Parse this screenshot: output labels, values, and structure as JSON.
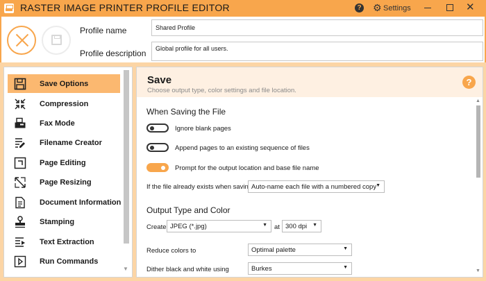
{
  "window": {
    "title": "RASTER IMAGE PRINTER PROFILE EDITOR",
    "help_glyph": "?",
    "settings_glyph": "⚙",
    "settings_label": "Settings",
    "close_glyph": "✕",
    "accent_color": "#f8a64c"
  },
  "profile": {
    "name_label": "Profile name",
    "name_value": "Shared Profile",
    "description_label": "Profile description",
    "description_value": "Global profile for all users."
  },
  "sidebar": {
    "items": [
      {
        "label": "Save Options",
        "icon": "floppy-disk-icon"
      },
      {
        "label": "Compression",
        "icon": "compress-arrows-icon"
      },
      {
        "label": "Fax Mode",
        "icon": "fax-machine-icon"
      },
      {
        "label": "Filename Creator",
        "icon": "filename-edit-icon"
      },
      {
        "label": "Page Editing",
        "icon": "page-crop-icon"
      },
      {
        "label": "Page Resizing",
        "icon": "resize-arrows-icon"
      },
      {
        "label": "Document Information",
        "icon": "document-info-icon"
      },
      {
        "label": "Stamping",
        "icon": "stamp-icon"
      },
      {
        "label": "Text Extraction",
        "icon": "text-extract-icon"
      },
      {
        "label": "Run Commands",
        "icon": "run-play-icon"
      }
    ],
    "active_index": 0
  },
  "main": {
    "title": "Save",
    "subtitle": "Choose output type, color settings and file location.",
    "help_glyph": "?",
    "saving_section": {
      "title": "When Saving the File",
      "toggles": [
        {
          "label": "Ignore blank pages",
          "on": false
        },
        {
          "label": "Append pages to an existing sequence of files",
          "on": false
        },
        {
          "label": "Prompt for the output location and base file name",
          "on": true
        }
      ],
      "exists_label": "If the file already exists when saving",
      "exists_value": "Auto-name each file with a numbered copy"
    },
    "output_section": {
      "title": "Output Type and Color",
      "create_label": "Create",
      "create_value": "JPEG (*.jpg)",
      "at_label": "at",
      "dpi_value": "300 dpi",
      "reduce_label": "Reduce colors to",
      "reduce_value": "Optimal palette",
      "dither_label": "Dither black and white using",
      "dither_value": "Burkes"
    }
  }
}
